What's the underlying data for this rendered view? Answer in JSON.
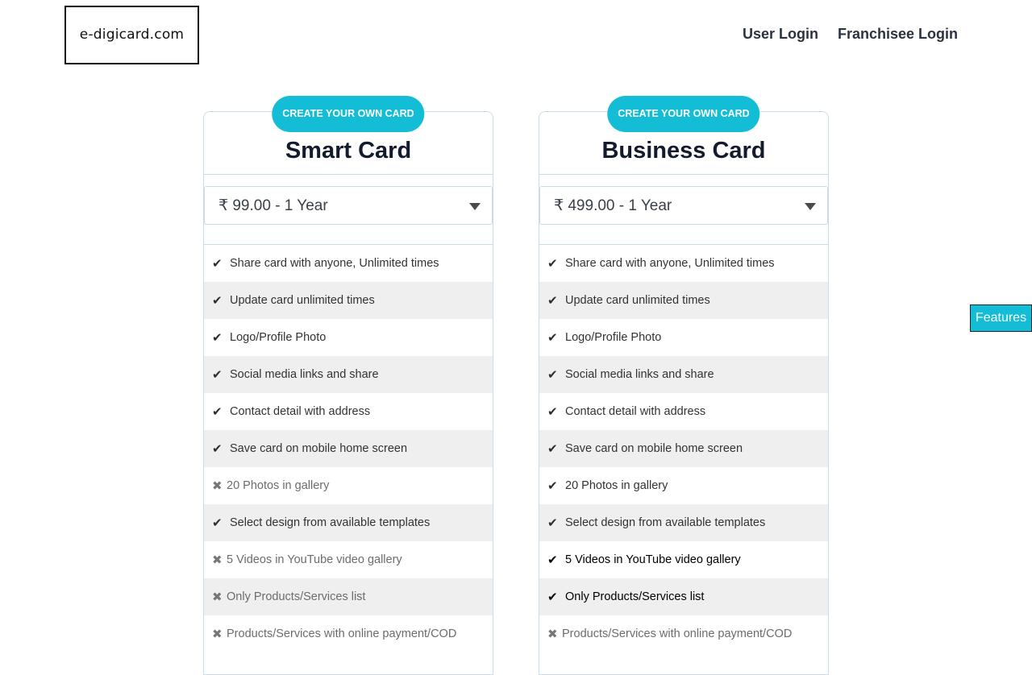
{
  "brand": {
    "logo_text": "e-digicard.com"
  },
  "nav": {
    "user_login": "User Login",
    "franchisee_login": "Franchisee Login"
  },
  "side_tab": {
    "label": "Features"
  },
  "cards": [
    {
      "ribbon": "CREATE YOUR OWN CARD",
      "title": "Smart Card",
      "plan_selected": "₹ 99.00 - 1 Year",
      "features": [
        {
          "text": "Share card with anyone, Unlimited times",
          "included": true
        },
        {
          "text": "Update card unlimited times",
          "included": true
        },
        {
          "text": "Logo/Profile Photo",
          "included": true
        },
        {
          "text": "Social media links and share",
          "included": true
        },
        {
          "text": "Contact detail with address",
          "included": true
        },
        {
          "text": "Save card on mobile home screen",
          "included": true
        },
        {
          "text": "20 Photos in gallery",
          "included": false
        },
        {
          "text": "Select design from available templates",
          "included": true
        },
        {
          "text": "5 Videos in YouTube video gallery",
          "included": false
        },
        {
          "text": "Only Products/Services list",
          "included": false
        },
        {
          "text": "Products/Services with online payment/COD",
          "included": false
        }
      ]
    },
    {
      "ribbon": "CREATE YOUR OWN CARD",
      "title": "Business Card",
      "plan_selected": "₹ 499.00 - 1 Year",
      "features": [
        {
          "text": "Share card with anyone, Unlimited times",
          "included": true
        },
        {
          "text": "Update card unlimited times",
          "included": true
        },
        {
          "text": "Logo/Profile Photo",
          "included": true
        },
        {
          "text": "Social media links and share",
          "included": true
        },
        {
          "text": "Contact detail with address",
          "included": true
        },
        {
          "text": "Save card on mobile home screen",
          "included": true
        },
        {
          "text": "20 Photos in gallery",
          "included": true
        },
        {
          "text": "Select design from available templates",
          "included": true
        },
        {
          "text": "5 Videos in YouTube video gallery",
          "included": true
        },
        {
          "text": "Only Products/Services list",
          "included": true
        },
        {
          "text": "Products/Services with online payment/COD",
          "included": false
        }
      ]
    }
  ],
  "icons": {
    "included": "check-icon",
    "excluded": "cross-icon",
    "dropdown": "chevron-down-icon"
  },
  "colors": {
    "accent": "#13bdd6",
    "title": "#141b2d",
    "border": "#c9dbe6",
    "row_alt": "#efefef"
  }
}
